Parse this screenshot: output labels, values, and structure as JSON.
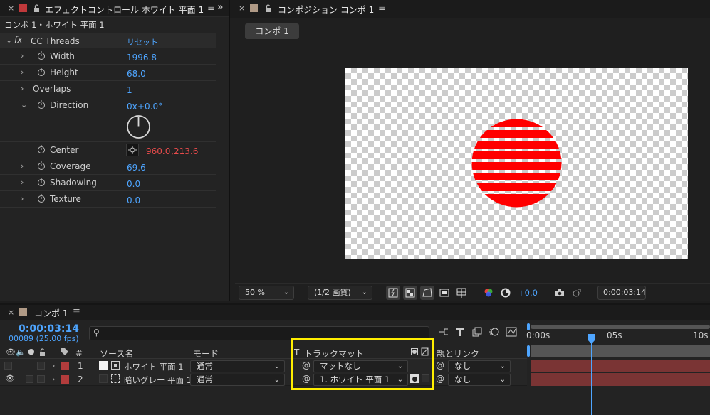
{
  "effect_controls": {
    "tab_close": "×",
    "tab_title": "エフェクトコントロール ホワイト 平面 1",
    "tab_overflow": "»",
    "menu_glyph": "≡",
    "subtitle": "コンポ 1・ホワイト 平面 1",
    "effect_name": "CC Threads",
    "fx_label": "fx",
    "reset_label": "リセット",
    "params": [
      {
        "name": "Width",
        "value": "1996.8"
      },
      {
        "name": "Height",
        "value": "68.0"
      },
      {
        "name": "Overlaps",
        "value": "1"
      },
      {
        "name": "Direction",
        "value_rev": "0x",
        "value_deg": "+0.0°"
      },
      {
        "name": "Center",
        "value_x": "960.0",
        "value_sep": ",",
        "value_y": "213.6"
      },
      {
        "name": "Coverage",
        "value": "69.6"
      },
      {
        "name": "Shadowing",
        "value": "0.0"
      },
      {
        "name": "Texture",
        "value": "0.0"
      }
    ]
  },
  "composition": {
    "tab_close": "×",
    "tab_title": "コンポジション コンポ 1",
    "menu_glyph": "≡",
    "subtab_label": "コンポ 1",
    "zoom_value": "50 %",
    "resolution_value": "(1/2 画質)",
    "exposure_value": "+0.0",
    "timecode": "0:00:03:14"
  },
  "timeline": {
    "tab_close": "×",
    "tab_title": "コンポ 1",
    "menu_glyph": "≡",
    "timecode": "0:00:03:14",
    "fps": "00089 (25.00 fps)",
    "columns": {
      "number": "#",
      "source_name": "ソース名",
      "mode": "モード",
      "t": "T",
      "track_matte": "トラックマット",
      "parent_link": "親とリンク"
    },
    "layers": [
      {
        "number": "1",
        "name": "ホワイト 平面 1",
        "mode": "通常",
        "matte": "マットなし",
        "parent": "なし"
      },
      {
        "number": "2",
        "name": "暗いグレー 平面 1",
        "mode": "通常",
        "matte": "1. ホワイト 平面 1",
        "parent": "なし"
      }
    ],
    "ruler_labels": [
      "0:00s",
      "05s",
      "10s"
    ],
    "colors": {
      "accent": "#4ea5ff",
      "label_red": "#b23c3c",
      "highlight": "#ffee00",
      "layer_bar": "#7a3434"
    }
  }
}
